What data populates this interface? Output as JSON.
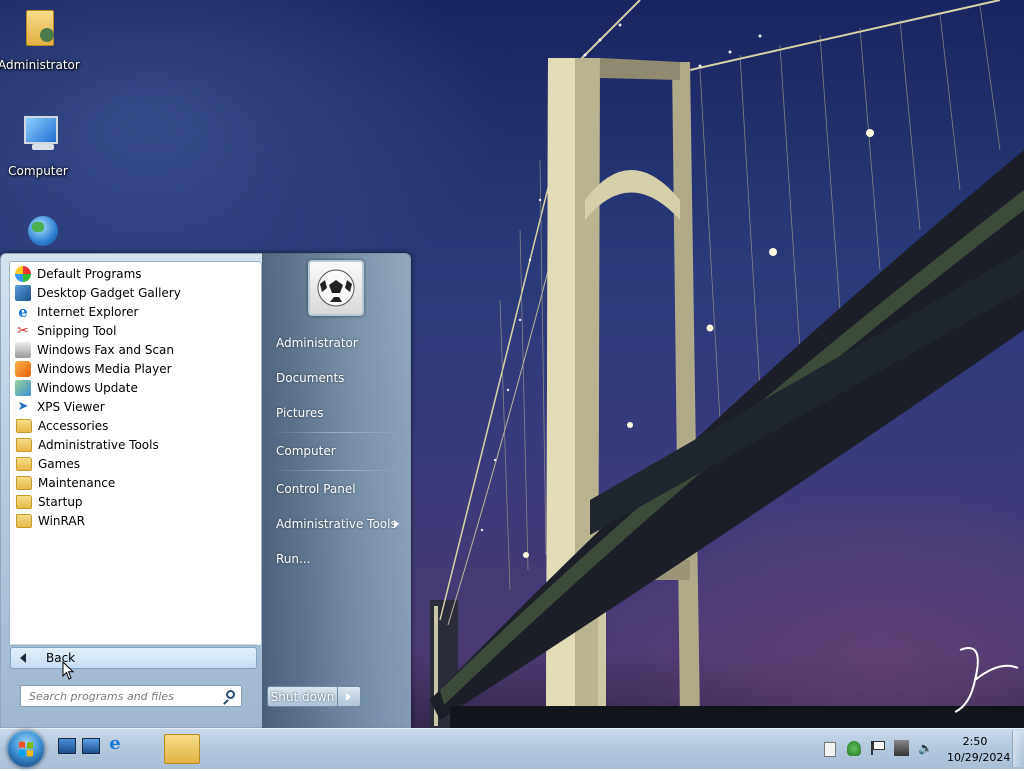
{
  "desktop": {
    "icons": [
      {
        "label": "Administrator",
        "icon": "user-folder-icon"
      },
      {
        "label": "Computer",
        "icon": "computer-icon"
      },
      {
        "label": "",
        "icon": "network-icon"
      }
    ]
  },
  "start_menu": {
    "programs": [
      {
        "label": "Default Programs",
        "icon": "default-programs-icon"
      },
      {
        "label": "Desktop Gadget Gallery",
        "icon": "gadget-gallery-icon"
      },
      {
        "label": "Internet Explorer",
        "icon": "internet-explorer-icon"
      },
      {
        "label": "Snipping Tool",
        "icon": "scissors-icon"
      },
      {
        "label": "Windows Fax and Scan",
        "icon": "fax-icon"
      },
      {
        "label": "Windows Media Player",
        "icon": "media-player-icon"
      },
      {
        "label": "Windows Update",
        "icon": "windows-update-icon"
      },
      {
        "label": "XPS Viewer",
        "icon": "xps-viewer-icon"
      },
      {
        "label": "Accessories",
        "icon": "folder-icon"
      },
      {
        "label": "Administrative Tools",
        "icon": "folder-icon"
      },
      {
        "label": "Games",
        "icon": "folder-icon"
      },
      {
        "label": "Maintenance",
        "icon": "folder-icon"
      },
      {
        "label": "Startup",
        "icon": "folder-icon"
      },
      {
        "label": "WinRAR",
        "icon": "folder-icon"
      }
    ],
    "back_label": "Back",
    "search_placeholder": "Search programs and files",
    "right_items": [
      {
        "label": "Administrator"
      },
      {
        "label": "Documents"
      },
      {
        "label": "Pictures"
      },
      {
        "label": "Computer"
      },
      {
        "label": "Control Panel"
      },
      {
        "label": "Administrative Tools"
      },
      {
        "label": "Run..."
      }
    ],
    "shutdown_label": "Shut down"
  },
  "taskbar": {
    "clock_time": "2:50",
    "clock_date": "10/29/2024"
  },
  "colors": {
    "start_menu_bg": "#b9cfe2",
    "taskbar_bg": "#b3c8dd",
    "right_pane_text": "#ffffff"
  }
}
